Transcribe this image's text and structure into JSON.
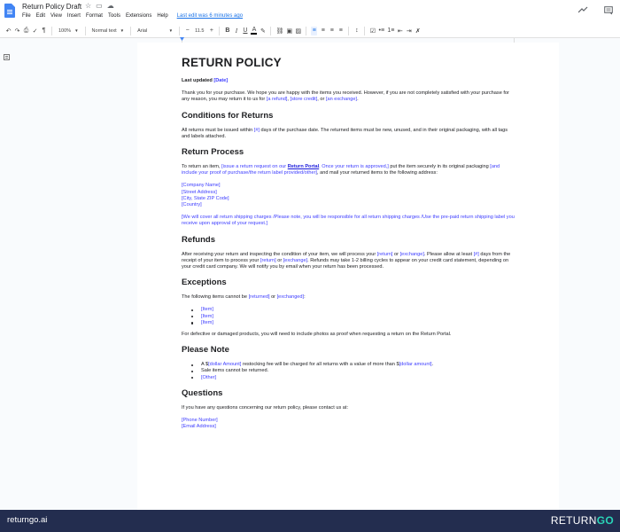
{
  "app": {
    "doc_title": "Return Policy Draft",
    "menu": [
      "File",
      "Edit",
      "View",
      "Insert",
      "Format",
      "Tools",
      "Extensions",
      "Help"
    ],
    "last_edit": "Last edit was 6 minutes ago"
  },
  "toolbar": {
    "zoom": "100%",
    "style": "Normal text",
    "font": "Arial",
    "font_size": "11.5",
    "bold": "B",
    "italic": "I",
    "underline": "U",
    "text_color": "A"
  },
  "doc": {
    "title": "RETURN POLICY",
    "last_updated_label": "Last updated",
    "last_updated_value": "[Date]",
    "intro": {
      "t1": "Thank you for your purchase. We hope you are happy with the items you received. However, if you are not completely satisfied with your purchase for any reason, you may return it to us for ",
      "p1": "[a refund]",
      "t2": ", ",
      "p2": "[store credit]",
      "t3": ", or ",
      "p3": "[an exchange]",
      "t4": "."
    },
    "conditions": {
      "heading": "Conditions for Returns",
      "t1": "All returns must be issued within ",
      "p1": "[#]",
      "t2": " days of the purchase date. The returned items must be new, unused, and in their original packaging, with all tags and labels attached."
    },
    "process": {
      "heading": "Return Process",
      "t1": "To return an item, ",
      "p1": "[issue a return request on our ",
      "link": "Return Portal",
      "p2": ". Once your return is approved,]",
      "t2": " put the item securely in its original packaging ",
      "p3": "[and include your proof of purchase/the return label provided/other]",
      "t3": ", and mail your returned items to the following address:",
      "address": [
        "[Company Name]",
        "[Street Address]",
        "[City, State ZIP Code]",
        "[Country]"
      ],
      "shipping_note": "[We will cover all return shipping charges /Please note, you will be responsible for all return shipping charges /Use the pre-paid return shipping label you receive upon approval of your request.]"
    },
    "refunds": {
      "heading": "Refunds",
      "t1": "After receiving your return and inspecting the condition of your item, we will process your ",
      "p1": "[return]",
      "t2": " or ",
      "p2": "[exchange]",
      "t3": ". Please allow at least ",
      "p3": "[#]",
      "t4": " days from the receipt of your item to process your ",
      "p4": "[return]",
      "t5": " or ",
      "p5": "[exchange]",
      "t6": ". Refunds may take 1-2 billing cycles to appear on your credit card statement, depending on your credit card company. We will notify you by email when your return has been processed."
    },
    "exceptions": {
      "heading": "Exceptions",
      "t1": "The following items cannot be ",
      "p1": "[returned]",
      "t2": " or ",
      "p2": "[exchanged]",
      "t3": ":",
      "items": [
        "[Item]",
        "[Item]",
        "[Item]"
      ],
      "damaged_note": "For defective or damaged products, you will need to include photos as proof when requesting a return on the Return Portal."
    },
    "note": {
      "heading": "Please Note",
      "b1_t1": "A $",
      "b1_p1": "[dollar Amount]",
      "b1_t2": " restocking fee will be charged for all returns with a value of more than $",
      "b1_p2": "[dollar amount]",
      "b1_t3": ".",
      "b2": "Sale items cannot be returned.",
      "b3": "[Other]"
    },
    "questions": {
      "heading": "Questions",
      "text": "If you have any questions concerning our return policy, please contact us at:",
      "phone": "[Phone Number]",
      "email": "[Email Address]"
    }
  },
  "footer": {
    "site": "returngo.ai",
    "logo_return": "RETURN",
    "logo_go": "GO"
  }
}
